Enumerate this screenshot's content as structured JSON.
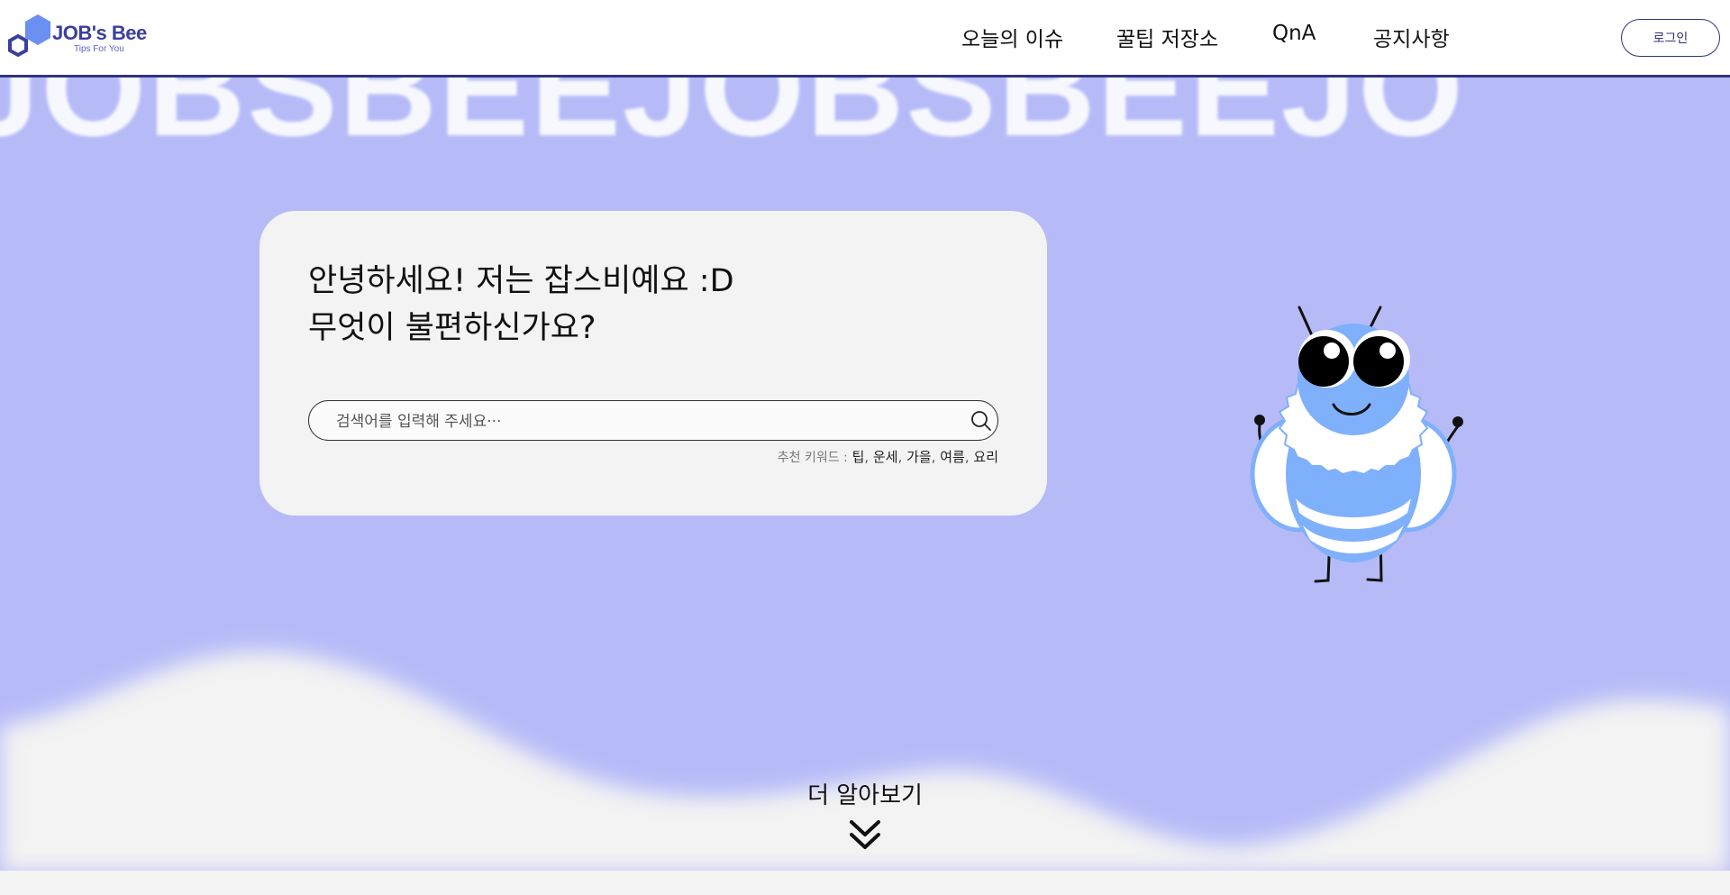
{
  "brand": {
    "title": "JOB's Bee",
    "subtitle": "Tips For You"
  },
  "nav": {
    "items": [
      {
        "label": "오늘의 이슈"
      },
      {
        "label": "꿀팁 저장소"
      },
      {
        "label": "QnA"
      },
      {
        "label": "공지사항"
      }
    ],
    "login_label": "로그인"
  },
  "hero": {
    "background_text": "JOBSBEEJOBSBEEJO",
    "greeting_line1": "안녕하세요! 저는 잡스비예요 :D",
    "greeting_line2": "무엇이 불편하신가요?",
    "search": {
      "placeholder": "검색어를 입력해 주세요···",
      "value": ""
    },
    "keywords_label": "추천 키워드 :",
    "keywords": [
      "팁",
      "운세",
      "가을",
      "여름",
      "요리"
    ],
    "more_label": "더 알아보기"
  },
  "colors": {
    "hero_bg": "#b6bbf8",
    "page_bg": "#f3f3f3",
    "brand_navy": "#2f3580",
    "bee_blue": "#7fb0fb"
  },
  "icons": {
    "logo": "hexagon-logo-icon",
    "search": "search-icon",
    "more": "double-chevron-down-icon",
    "mascot": "bee-mascot"
  }
}
